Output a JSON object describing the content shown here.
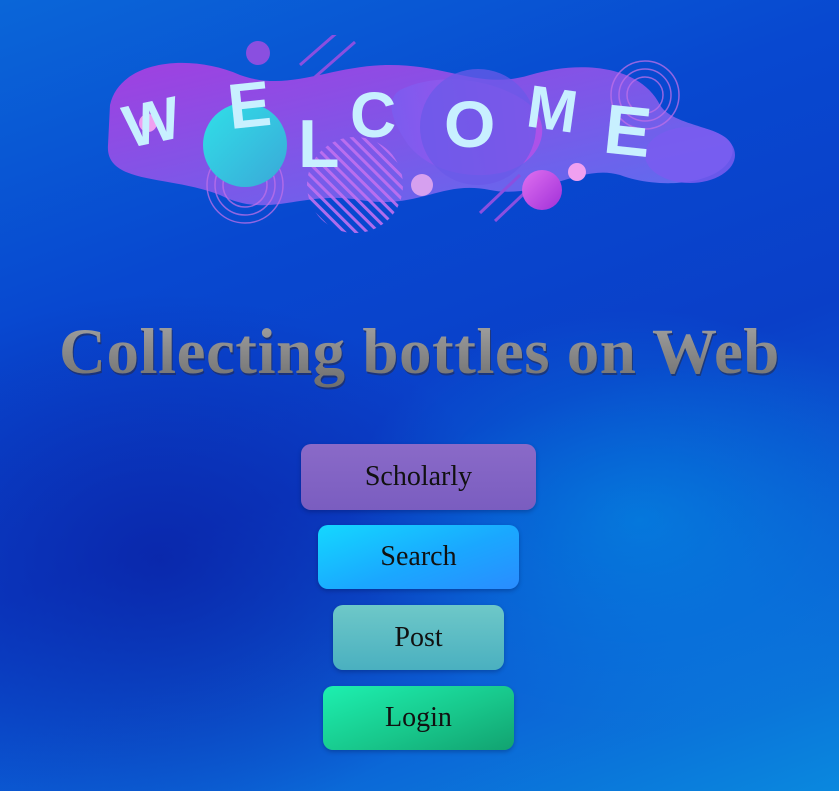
{
  "banner": {
    "letters": [
      "W",
      "E",
      "L",
      "C",
      "O",
      "M",
      "E"
    ],
    "icon": "welcome-banner-graphic"
  },
  "title": "Collecting bottles on Web",
  "buttons": {
    "scholarly": "Scholarly",
    "search": "Search",
    "post": "Post",
    "login": "Login"
  },
  "colors": {
    "background": "#0a4fd0",
    "scholarly": "#7f62c4",
    "search": "#1ab8ff",
    "post": "#5cbcc4",
    "login": "#18c88c",
    "title": "#8a8a8a"
  }
}
